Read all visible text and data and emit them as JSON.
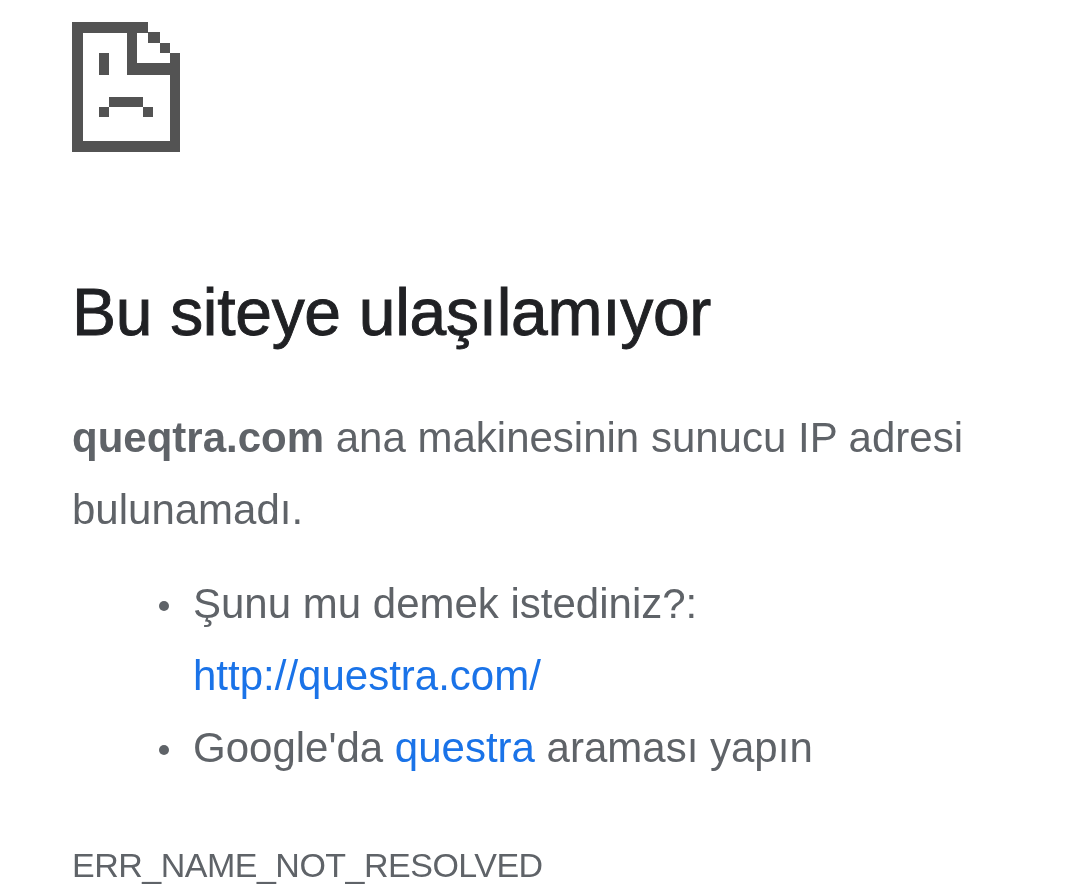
{
  "heading": "Bu siteye ulaşılamıyor",
  "message": "**queqtra.com** ana makinesinin sunucu IP adresi bulunamadı.",
  "suggestions": [
    {
      "parts": [
        {
          "kind": "text",
          "text": "Şunu mu demek istediniz?:"
        },
        {
          "kind": "link",
          "text": "http://questra.com/"
        }
      ]
    },
    {
      "parts": [
        {
          "kind": "text",
          "text": "Google'da"
        },
        {
          "kind": "link",
          "text": "questra"
        },
        {
          "kind": "text",
          "text": "araması yapın"
        }
      ]
    }
  ],
  "error_code": "ERR_NAME_NOT_RESOLVED"
}
